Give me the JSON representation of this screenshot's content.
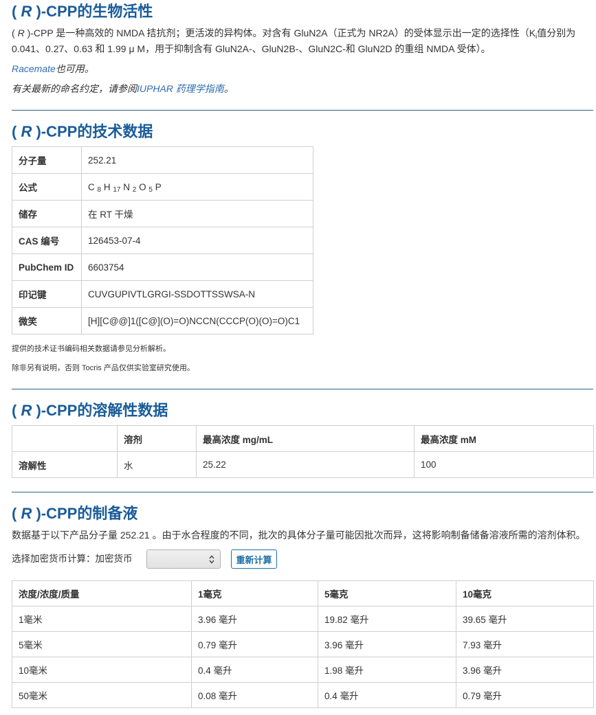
{
  "colors": {
    "heading": "#1a5c99",
    "link": "#2e6cb0",
    "text": "#333333",
    "rule": "#2e6086",
    "border": "#cfcfcf",
    "button": "#1f6fa8"
  },
  "biological_activity": {
    "heading": {
      "open": "( ",
      "italic": "R",
      "rest": " )-CPP的生物活性"
    },
    "description": {
      "open": "( ",
      "italic": "R",
      "text": " )-CPP 是一种高效的 NMDA 拮抗剂；更活泼的异构体。对含有 GluN2A（正式为 NR2A）的受体显示出一定的选择性（K",
      "subscript": "i",
      "tail": "值分别为",
      "line2": "0.041、0.27、0.63 和 1.99 μ M，用于抑制含有 GluN2A-、GluN2B-、GluN2C-和 GluN2D 的重组 NMDA 受体）。"
    },
    "racemate": {
      "link": "Racemate",
      "text": "也可用。"
    },
    "nomenclature": {
      "text": "有关最新的命名约定，请参阅",
      "link": "IUPHAR 药理学指南",
      "end": "。"
    }
  },
  "technical_data": {
    "heading": {
      "open": "( ",
      "italic": "R",
      "rest": " )-CPP的技术数据"
    },
    "rows": [
      {
        "label": "分子量",
        "value": "252.21"
      },
      {
        "label": "公式",
        "formula": [
          {
            "element": "C",
            "count": "8"
          },
          {
            "element": "H",
            "count": "17"
          },
          {
            "element": "N",
            "count": "2"
          },
          {
            "element": "O",
            "count": "5"
          },
          {
            "element": "P"
          }
        ]
      },
      {
        "label": "储存",
        "value": "在 RT 干燥"
      },
      {
        "label": "CAS 编号",
        "value": "126453-07-4"
      },
      {
        "label": "PubChem ID",
        "value": "6603754"
      },
      {
        "label": "印记键",
        "value": "CUVGUPIVTLGRGI-SSDOTTSSWSA-N"
      },
      {
        "label": "微笑",
        "value": "[H][C@@]1([C@](O)=O)NCCN(CCCP(O)(O)=O)C1"
      }
    ],
    "notes": [
      "提供的技术证书编码相关数据请参见分析解析。",
      "除非另有说明，否则 Tocris 产品仅供实验室研究使用。"
    ]
  },
  "solubility": {
    "heading": {
      "open": "( ",
      "italic": "R",
      "rest": " )-CPP的溶解性数据"
    },
    "columns": [
      "溶剂",
      "最高浓度 mg/mL",
      "最高浓度 mM"
    ],
    "rows": [
      [
        "溶解性",
        "水",
        "25.22",
        "100"
      ]
    ]
  },
  "stock_solutions": {
    "heading": {
      "open": "( ",
      "italic": "R",
      "rest": " )-CPP的制备液"
    },
    "intro": "数据基于以下产品分子量 252.21 。由于水合程度的不同，批次的具体分子量可能因批次而异，这将影响制备储备溶液所需的溶剂体积。",
    "currency_label": "选择加密货币计算：加密货币",
    "select_icon": "select-arrows-icon",
    "recalc_button": "重新计算",
    "columns": [
      "浓度/浓度/质量",
      "1毫克",
      "5毫克",
      "10毫克"
    ],
    "rows": [
      [
        "1毫米",
        "3.96 毫升",
        "19.82 毫升",
        "39.65 毫升"
      ],
      [
        "5毫米",
        "0.79 毫升",
        "3.96 毫升",
        "7.93 毫升"
      ],
      [
        "10毫米",
        "0.4 毫升",
        "1.98 毫升",
        "3.96 毫升"
      ],
      [
        "50毫米",
        "0.08 毫升",
        "0.4 毫升",
        "0.79 毫升"
      ]
    ]
  }
}
